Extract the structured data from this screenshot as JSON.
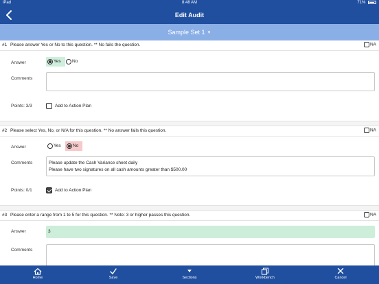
{
  "statusbar": {
    "carrier": "iPad",
    "time": "8:48 AM",
    "battery": "71%"
  },
  "navbar": {
    "title": "Edit Audit"
  },
  "setbar": {
    "label": "Sample Set 1"
  },
  "questions": [
    {
      "number": "#1",
      "text": "Please answer Yes or No to this question. ** No fails the question.",
      "na_label": "NA",
      "answer_label": "Answer",
      "options": [
        "Yes",
        "No"
      ],
      "selected": "Yes",
      "comments_label": "Comments",
      "comments": [],
      "points": "Points: 3/3",
      "action_label": "Add to Action Plan",
      "action_checked": false
    },
    {
      "number": "#2",
      "text": "Please select Yes, No, or N/A for this question. ** No answer fails this question.",
      "na_label": "NA",
      "answer_label": "Answer",
      "options": [
        "Yes",
        "No"
      ],
      "selected": "No",
      "comments_label": "Comments",
      "comments": [
        "Please update the Cash Variance sheet daily",
        "Please have two signatures on all cash amounts greater than $500.00"
      ],
      "points": "Points: 0/1",
      "action_label": "Add to Action Plan",
      "action_checked": true
    },
    {
      "number": "#3",
      "text": "Please enter a range from 1 to 5 for this question. ** Note: 3 or higher passes this question.",
      "na_label": "NA",
      "answer_label": "Answer",
      "answer_value": "3",
      "comments_label": "Comments"
    }
  ],
  "tabbar": {
    "items": [
      {
        "label": "Home",
        "icon": "home-icon"
      },
      {
        "label": "Save",
        "icon": "checkmark-icon"
      },
      {
        "label": "Sections",
        "icon": "caret-down-icon"
      },
      {
        "label": "Workbench",
        "icon": "workbench-icon"
      },
      {
        "label": "Cancel",
        "icon": "close-icon"
      }
    ]
  },
  "colors": {
    "primary": "#1f4f9e",
    "set_bar": "#8aaee6",
    "yes_selected": "#cfeedd",
    "no_selected": "#f6c9cb",
    "answer_fill": "#cdeed9"
  }
}
